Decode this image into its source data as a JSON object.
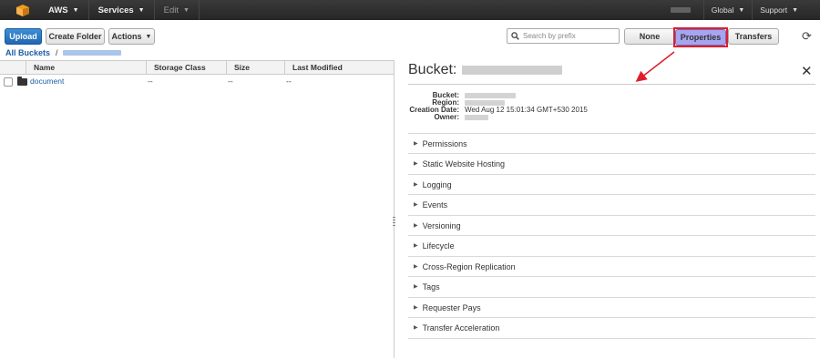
{
  "nav": {
    "aws_label": "AWS",
    "services_label": "Services",
    "edit_label": "Edit",
    "region_label": "Global",
    "support_label": "Support"
  },
  "toolbar": {
    "upload_label": "Upload",
    "create_folder_label": "Create Folder",
    "actions_label": "Actions",
    "search_placeholder": "Search by prefix",
    "none_label": "None",
    "properties_label": "Properties",
    "transfers_label": "Transfers"
  },
  "breadcrumb": {
    "root_label": "All Buckets",
    "separator": "/"
  },
  "table": {
    "columns": [
      "Name",
      "Storage Class",
      "Size",
      "Last Modified"
    ],
    "rows": [
      {
        "name": "document",
        "storage_class": "--",
        "size": "--",
        "last_modified": "--"
      }
    ]
  },
  "panel": {
    "title": "Bucket:",
    "info": {
      "bucket_label": "Bucket:",
      "region_label": "Region:",
      "creation_date_label": "Creation Date:",
      "creation_date_value": "Wed Aug 12 15:01:34 GMT+530 2015",
      "owner_label": "Owner:"
    },
    "sections": [
      "Permissions",
      "Static Website Hosting",
      "Logging",
      "Events",
      "Versioning",
      "Lifecycle",
      "Cross-Region Replication",
      "Tags",
      "Requester Pays",
      "Transfer Acceleration"
    ]
  },
  "colors": {
    "nav_bg": "#2b2b2b",
    "primary_button": "#1f67b1",
    "selected_tab": "#a7a4f0",
    "highlight": "#e01e2a",
    "link": "#1a5fa6"
  }
}
